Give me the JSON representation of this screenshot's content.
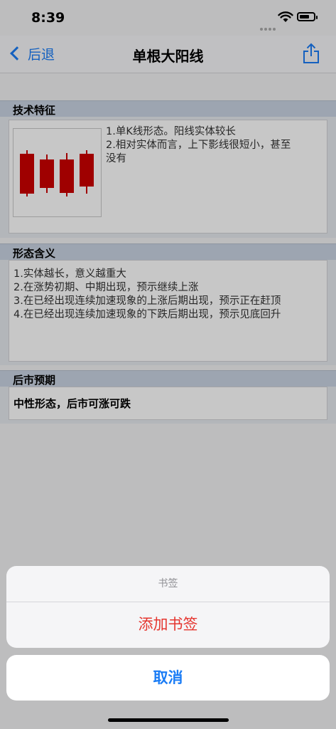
{
  "status": {
    "time": "8:39"
  },
  "nav": {
    "back_label": "后退",
    "title": "单根大阳线"
  },
  "sections": {
    "features": {
      "header": "技术特征",
      "lines": [
        "1.单K线形态。阳线实体较长",
        "2.相对实体而言，上下影线很短小，甚至",
        "没有"
      ]
    },
    "meaning": {
      "header": "形态含义",
      "lines": [
        "1.实体越长，意义越重大",
        "2.在涨势初期、中期出现，预示继续上涨",
        "3.在已经出现连续加速现象的上涨后期出现，预示正在赶顶",
        "4.在已经出现连续加速现象的下跌后期出现，预示见底回升"
      ]
    },
    "outlook": {
      "header": "后市预期",
      "text": "中性形态，后市可涨可跌"
    }
  },
  "action_sheet": {
    "title": "书签",
    "add_bookmark": "添加书签",
    "cancel": "取消"
  },
  "colors": {
    "accent": "#1a7cf5",
    "destructive": "#e5352f",
    "candle": "#cc0000"
  }
}
